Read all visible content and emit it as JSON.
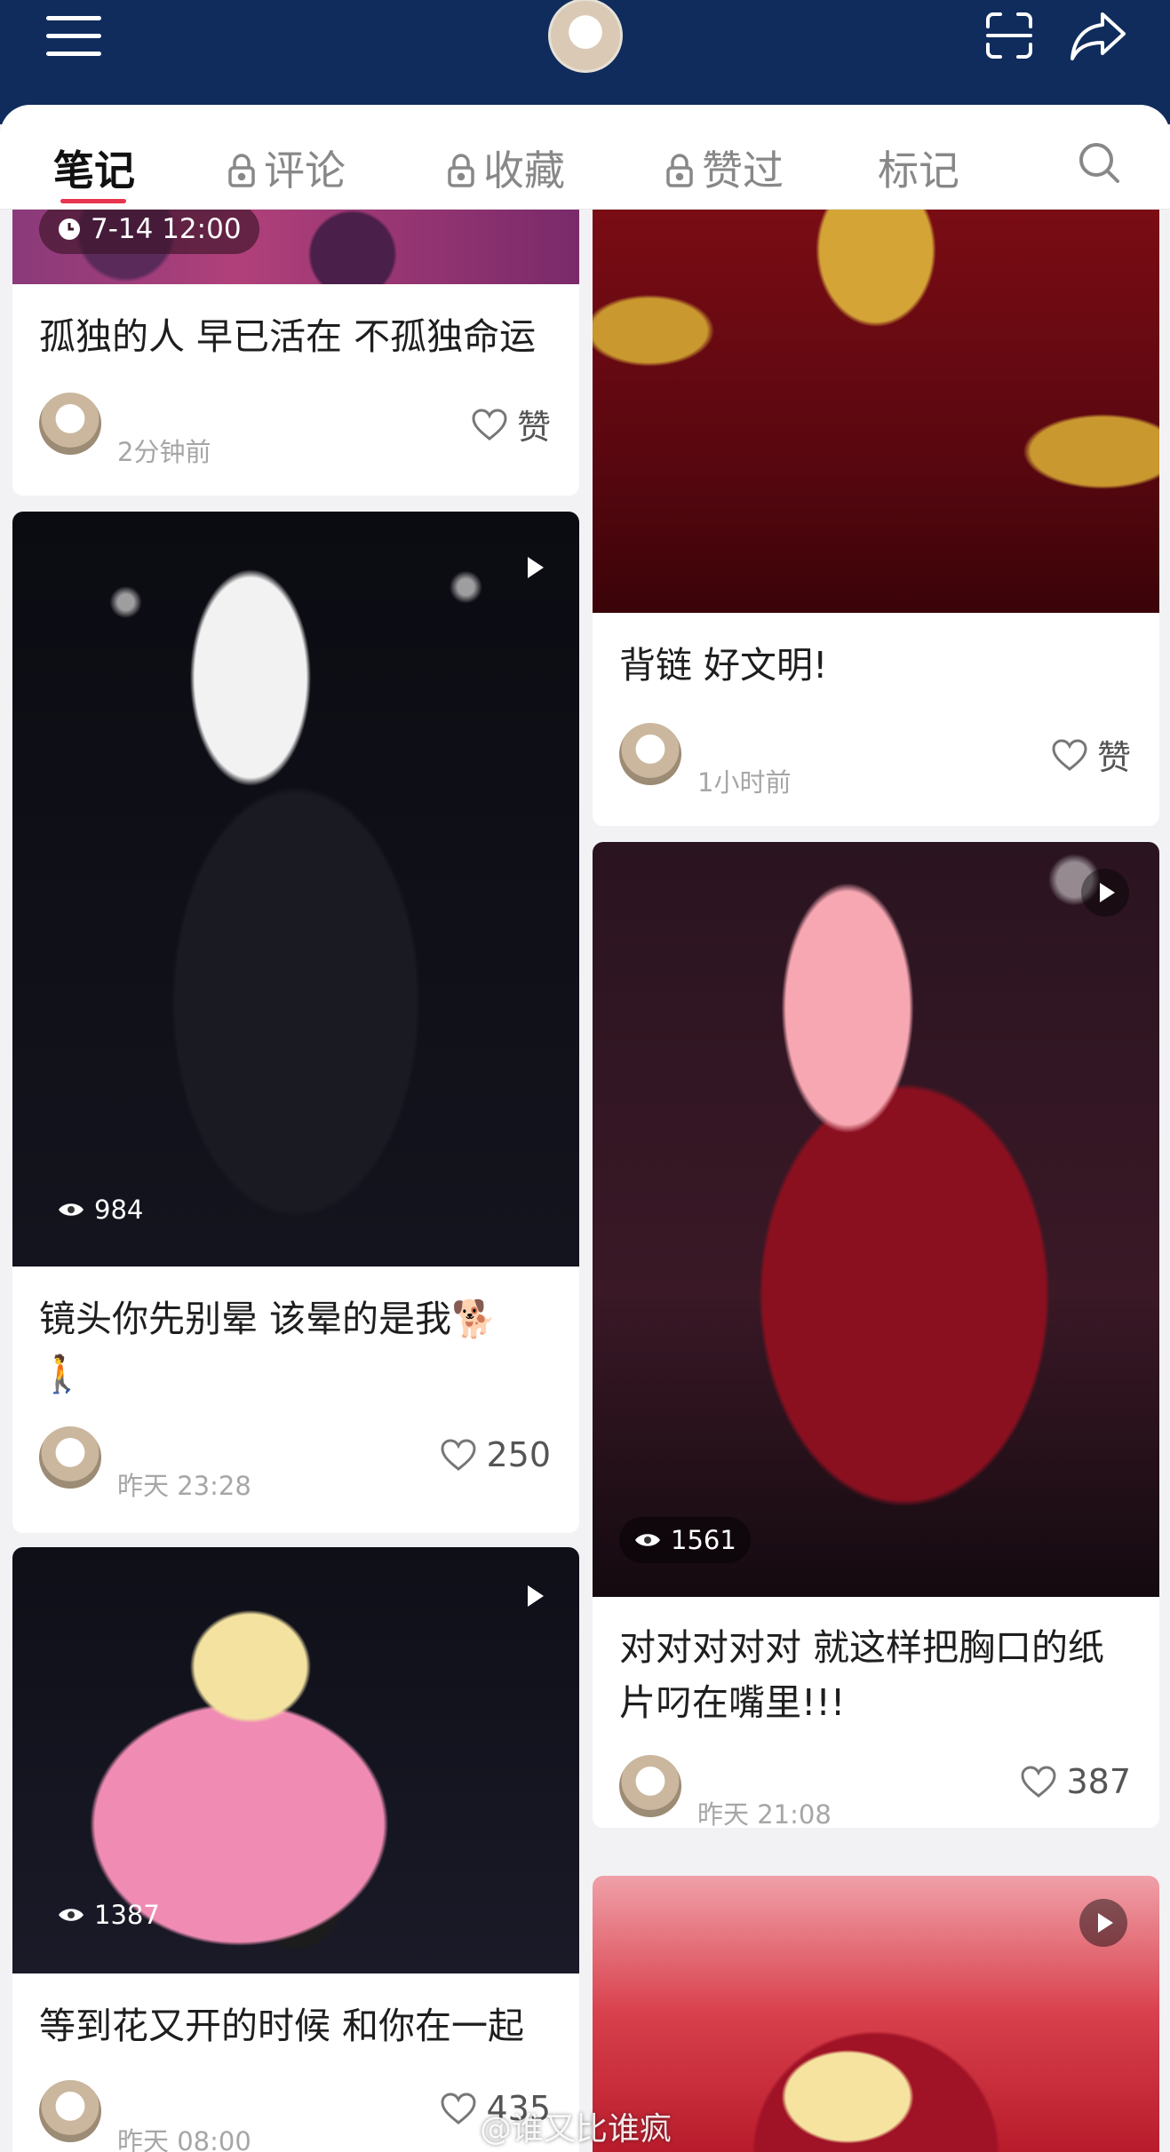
{
  "colors": {
    "topbar": "#0f2c5c",
    "accent": "#e8344e"
  },
  "tabs": [
    {
      "label": "笔记",
      "locked": false,
      "active": true
    },
    {
      "label": "评论",
      "locked": true
    },
    {
      "label": "收藏",
      "locked": true
    },
    {
      "label": "赞过",
      "locked": true
    },
    {
      "label": "标记",
      "locked": false
    }
  ],
  "cards": {
    "c1": {
      "badge_time": "7-14 12:00",
      "title": "孤独的人 早已活在 不孤独命运",
      "time": "2分钟前",
      "likes": "赞"
    },
    "c2": {
      "title": "背链 好文明!",
      "time": "1小时前",
      "likes": "赞"
    },
    "c3": {
      "views": "984",
      "title": "镜头你先别晕 该晕的是我🐕🚶",
      "time": "昨天 23:28",
      "likes": "250"
    },
    "c4": {
      "views": "1561",
      "title": "对对对对对 就这样把胸口的纸片叼在嘴里!!!",
      "time": "昨天 21:08",
      "likes": "387"
    },
    "c5": {
      "views": "1387",
      "title": "等到花又开的时候 和你在一起",
      "time": "昨天 08:00",
      "likes": "435"
    }
  },
  "watermark": "@谁又比谁疯"
}
